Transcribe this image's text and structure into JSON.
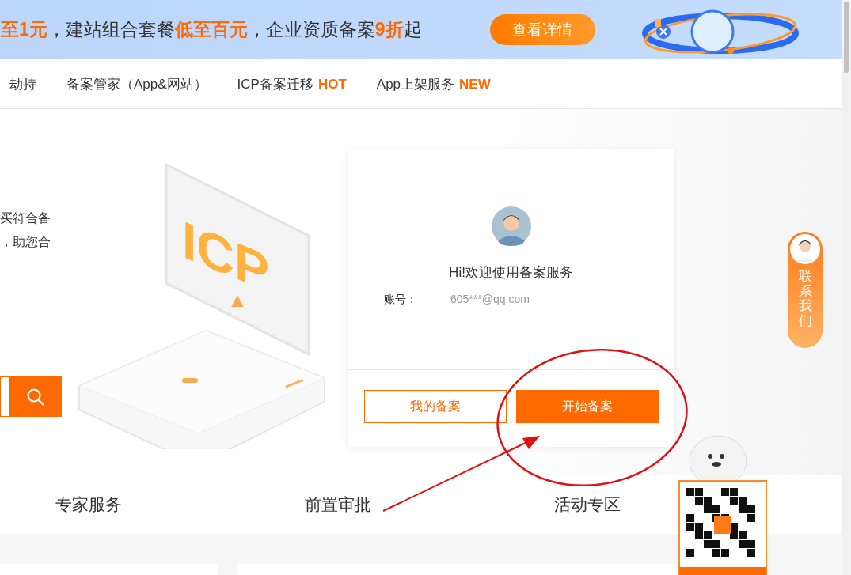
{
  "promo_banner": {
    "segments": [
      {
        "text": "至1元",
        "highlight": true
      },
      {
        "text": "，建站组合套餐",
        "highlight": false
      },
      {
        "text": "低至百元",
        "highlight": true
      },
      {
        "text": "，企业资质备案",
        "highlight": false
      },
      {
        "text": "9折",
        "highlight": true
      },
      {
        "text": "起",
        "highlight": false
      }
    ],
    "button": "查看详情"
  },
  "nav": {
    "items": [
      {
        "label": "劫持"
      },
      {
        "label": "备案管家（App&网站）"
      },
      {
        "label": "ICP备案迁移",
        "tag": "HOT"
      },
      {
        "label": "App上架服务",
        "tag": "NEW"
      }
    ]
  },
  "hero": {
    "description_lines": [
      "买符合备",
      "，助您合"
    ],
    "illustration_text": "ICP"
  },
  "login_card": {
    "greeting": "Hi!欢迎使用备案服务",
    "account_label": "账号：",
    "account_value": "605***@qq.com",
    "buttons": [
      {
        "label": "我的备案",
        "kind": "outline"
      },
      {
        "label": "开始备案",
        "kind": "filled"
      }
    ]
  },
  "contact": {
    "label": "联系我们"
  },
  "features": [
    "专家服务",
    "前置审批",
    "活动专区"
  ]
}
